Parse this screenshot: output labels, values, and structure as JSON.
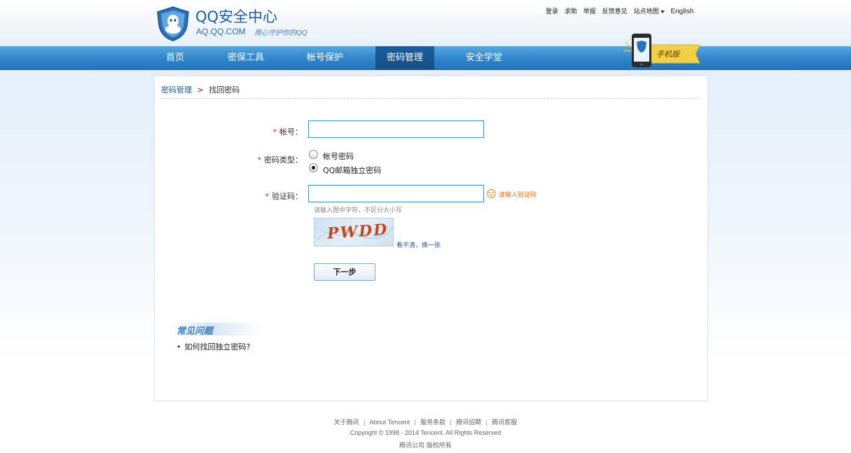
{
  "header": {
    "title": "QQ安全中心",
    "domain": "AQ.QQ.COM",
    "slogan": "用心守护你的QQ",
    "top_links": [
      "登录",
      "求助",
      "举报",
      "反馈意见",
      "站点地图"
    ],
    "language": "English",
    "mobile_badge": "手机版"
  },
  "nav": {
    "items": [
      "首页",
      "密保工具",
      "帐号保护",
      "密码管理",
      "安全学堂"
    ],
    "active": "密码管理"
  },
  "breadcrumb": {
    "parent": "密码管理",
    "separator": ">",
    "current": "找回密码"
  },
  "form": {
    "required_mark": "*",
    "account_label": "帐号：",
    "account_value": "",
    "password_type_label": "密码类型：",
    "password_type_options": [
      "帐号密码",
      "QQ邮箱独立密码"
    ],
    "password_type_selected": "QQ邮箱独立密码",
    "captcha_label": "验证码：",
    "captcha_value": "",
    "captcha_warning": "请输入验证码",
    "captcha_hint": "请输入图中字符，不区分大小写",
    "captcha_text": "PWDD",
    "refresh_link": "看不清，换一张",
    "next_button": "下一步"
  },
  "faq": {
    "title": "常见问题",
    "items": [
      "如何找回独立密码?"
    ]
  },
  "footer": {
    "links": [
      "关于腾讯",
      "About Tencent",
      "服务条款",
      "腾讯招聘",
      "腾讯客服"
    ],
    "link_separator": "|",
    "copyright": "Copyright © 1998 - 2014 Tencent. All Rights Reserved",
    "company": "腾讯公司 版权所有"
  },
  "colors": {
    "nav_blue": "#2f86cb",
    "nav_active": "#174f86",
    "link_blue": "#1d5b9c",
    "required_red": "#e02020",
    "warning_orange": "#e66a10"
  }
}
